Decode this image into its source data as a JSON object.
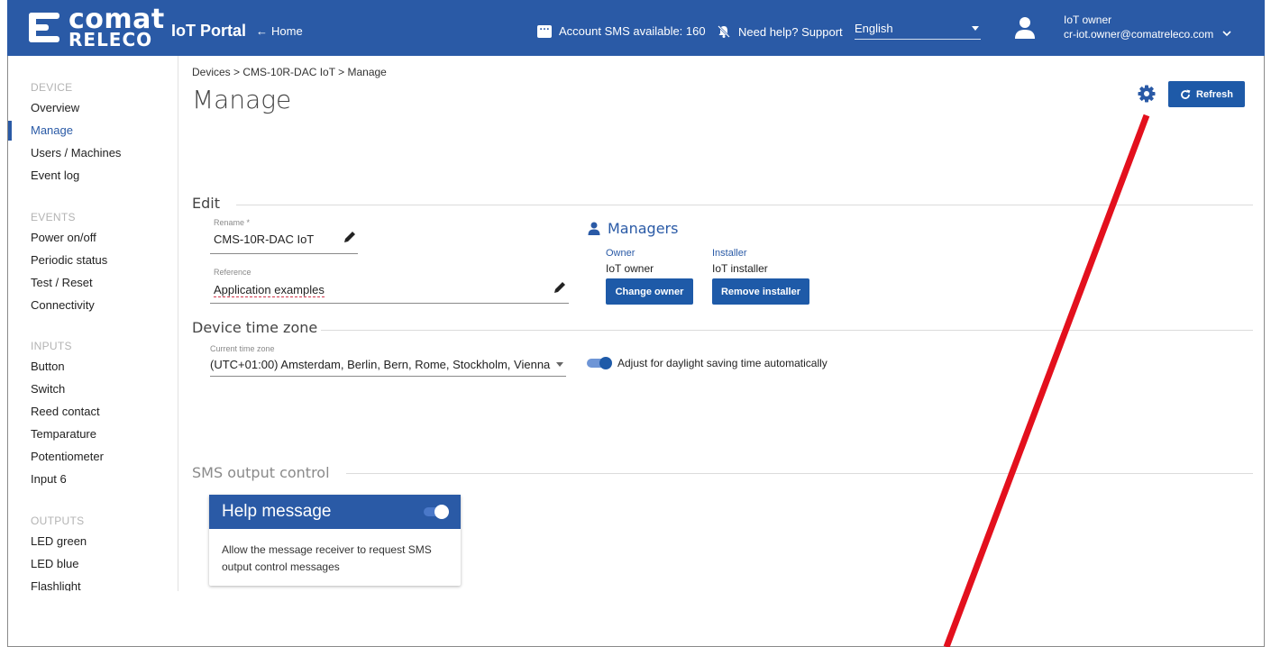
{
  "header": {
    "brand_top": "comat",
    "brand_bottom": "RELECO",
    "portal_title": "IoT Portal",
    "home_link": "Home",
    "sms_available": "Account SMS available: 160",
    "help": "Need help? Support",
    "language": "English",
    "user_name": "IoT owner",
    "user_email": "cr-iot.owner@comatreleco.com"
  },
  "sidebar": {
    "device_section": "DEVICE",
    "device_items": [
      "Overview",
      "Manage",
      "Users / Machines",
      "Event log"
    ],
    "events_section": "EVENTS",
    "events_items": [
      "Power on/off",
      "Periodic status",
      "Test / Reset",
      "Connectivity"
    ],
    "inputs_section": "INPUTS",
    "inputs_items": [
      "Button",
      "Switch",
      "Reed contact",
      "Temparature",
      "Potentiometer",
      "Input 6"
    ],
    "outputs_section": "OUTPUTS",
    "outputs_items": [
      "LED green",
      "LED blue",
      "Flashlight"
    ]
  },
  "main": {
    "breadcrumb": "Devices > CMS-10R-DAC IoT > Manage",
    "title": "Manage",
    "refresh_label": "Refresh",
    "edit": {
      "heading": "Edit",
      "rename_label": "Rename *",
      "rename_value": "CMS-10R-DAC IoT",
      "reference_label": "Reference",
      "reference_value": "Application examples"
    },
    "managers": {
      "heading": "Managers",
      "owner_role": "Owner",
      "owner_name": "IoT owner",
      "installer_role": "Installer",
      "installer_name": "IoT installer",
      "change_owner_label": "Change owner",
      "remove_installer_label": "Remove installer"
    },
    "timezone": {
      "heading": "Device time zone",
      "label": "Current time zone",
      "value": "(UTC+01:00) Amsterdam, Berlin, Bern, Rome, Stockholm, Vienna",
      "dst_label": "Adjust for daylight saving time automatically",
      "dst_enabled": true
    },
    "sms_output": {
      "heading": "SMS output control",
      "card_title": "Help message",
      "card_enabled": true,
      "card_text": "Allow the message receiver to request SMS output control messages"
    }
  },
  "colors": {
    "brand_blue": "#2a5aa6",
    "button_blue": "#1e5aa8",
    "annotation_red": "#e3101d"
  }
}
